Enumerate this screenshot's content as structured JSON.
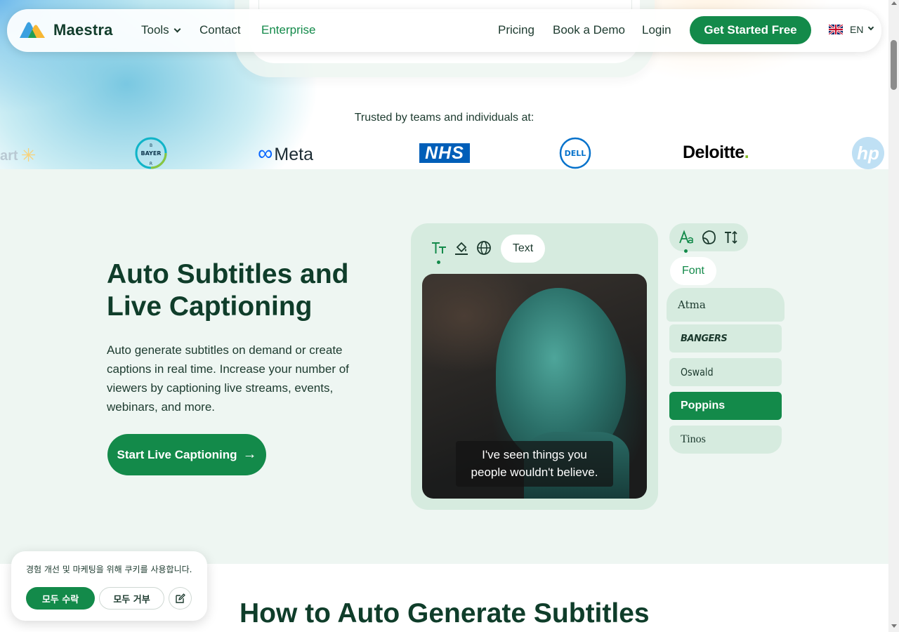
{
  "navbar": {
    "brand": "Maestra",
    "items": [
      {
        "label": "Tools"
      },
      {
        "label": "Contact"
      },
      {
        "label": "Enterprise"
      },
      {
        "label": "Pricing"
      },
      {
        "label": "Book a Demo"
      },
      {
        "label": "Login"
      }
    ],
    "cta": "Get Started Free",
    "language": "EN"
  },
  "trusted": {
    "heading": "Trusted by teams and individuals at:",
    "logos": [
      "art",
      "BAYER",
      "Meta",
      "NHS",
      "DELL",
      "Deloitte",
      "hp"
    ]
  },
  "feature": {
    "title": "Auto Subtitles and Live Captioning",
    "description": "Auto generate subtitles on demand or create captions in real time. Increase your number of viewers by captioning live streams, events, webinars, and more.",
    "cta": "Start Live Captioning",
    "editor": {
      "active_tool_label": "Text",
      "caption_lines": [
        "I've seen things you",
        "people wouldn't believe."
      ]
    },
    "font_panel": {
      "label": "Font",
      "fonts": [
        "Atma",
        "BANGERS",
        "Oswald",
        "Poppins",
        "Tinos"
      ],
      "selected": "Poppins"
    }
  },
  "how_section": {
    "title": "How to Auto Generate Subtitles"
  },
  "cookie": {
    "text": "경험 개선 및 마케팅을 위해 쿠키를 사용합니다.",
    "accept": "모두 수락",
    "reject": "모두 거부"
  },
  "colors": {
    "brand_green": "#138a4a",
    "section_bg": "#eef6f2",
    "panel_bg": "#d6ebdf",
    "heading": "#0f3d2a"
  }
}
